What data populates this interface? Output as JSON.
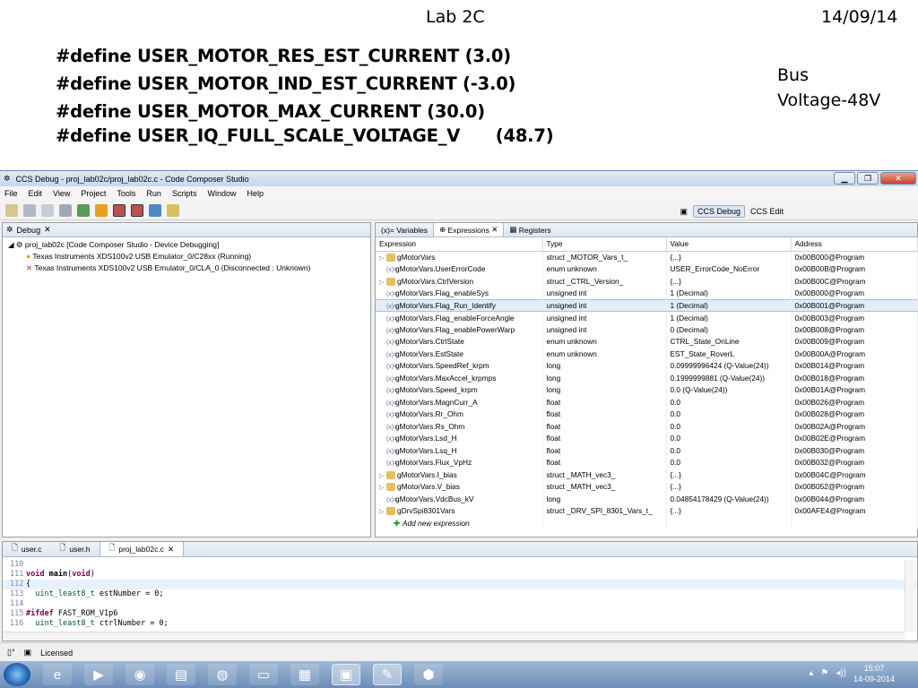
{
  "slide": {
    "title": "Lab 2C",
    "date": "14/09/14",
    "defines": [
      "#define USER_MOTOR_RES_EST_CURRENT (3.0)",
      "#define USER_MOTOR_IND_EST_CURRENT (-3.0)",
      "#define USER_MOTOR_MAX_CURRENT (30.0)",
      "#define USER_IQ_FULL_SCALE_VOLTAGE_V      (48.7)"
    ],
    "bus_line1": "Bus",
    "bus_line2": "Voltage-48V"
  },
  "window": {
    "title": "CCS Debug - proj_lab02c/proj_lab02c.c - Code Composer Studio",
    "menu": [
      "File",
      "Edit",
      "View",
      "Project",
      "Tools",
      "Run",
      "Scripts",
      "Window",
      "Help"
    ],
    "perspectives": [
      "CCS Debug",
      "CCS Edit"
    ]
  },
  "debug_view": {
    "tab": "Debug",
    "root": "proj_lab02c [Code Composer Studio - Device Debugging]",
    "children": [
      "Texas Instruments XDS100v2 USB Emulator_0/C28xx (Running)",
      "Texas Instruments XDS100v2 USB Emulator_0/CLA_0 (Disconnected : Unknown)"
    ]
  },
  "expressions_view": {
    "tabs": [
      "Variables",
      "Expressions",
      "Registers"
    ],
    "columns": [
      "Expression",
      "Type",
      "Value",
      "Address"
    ],
    "rows": [
      {
        "expr": "gMotorVars",
        "type": "struct _MOTOR_Vars_t_",
        "value": "{...}",
        "addr": "0x00B000@Program",
        "kind": "struct"
      },
      {
        "expr": "gMotorVars.UserErrorCode",
        "type": "enum unknown",
        "value": "USER_ErrorCode_NoError",
        "addr": "0x00B00B@Program",
        "kind": "var"
      },
      {
        "expr": "gMotorVars.CtrlVersion",
        "type": "struct _CTRL_Version_",
        "value": "{...}",
        "addr": "0x00B00C@Program",
        "kind": "struct"
      },
      {
        "expr": "gMotorVars.Flag_enableSys",
        "type": "unsigned int",
        "value": "1 (Decimal)",
        "addr": "0x00B000@Program",
        "kind": "var"
      },
      {
        "expr": "gMotorVars.Flag_Run_Identify",
        "type": "unsigned int",
        "value": "1 (Decimal)",
        "addr": "0x00B001@Program",
        "kind": "var"
      },
      {
        "expr": "gMotorVars.Flag_enableForceAngle",
        "type": "unsigned int",
        "value": "1 (Decimal)",
        "addr": "0x00B003@Program",
        "kind": "var"
      },
      {
        "expr": "gMotorVars.Flag_enablePowerWarp",
        "type": "unsigned int",
        "value": "0 (Decimal)",
        "addr": "0x00B008@Program",
        "kind": "var"
      },
      {
        "expr": "gMotorVars.CtrlState",
        "type": "enum unknown",
        "value": "CTRL_State_OnLine",
        "addr": "0x00B009@Program",
        "kind": "var"
      },
      {
        "expr": "gMotorVars.EstState",
        "type": "enum unknown",
        "value": "EST_State_RoverL",
        "addr": "0x00B00A@Program",
        "kind": "var"
      },
      {
        "expr": "gMotorVars.SpeedRef_krpm",
        "type": "long",
        "value": "0.09999996424 (Q-Value(24))",
        "addr": "0x00B014@Program",
        "kind": "var"
      },
      {
        "expr": "gMotorVars.MaxAccel_krpmps",
        "type": "long",
        "value": "0.1999999881 (Q-Value(24))",
        "addr": "0x00B018@Program",
        "kind": "var"
      },
      {
        "expr": "gMotorVars.Speed_krpm",
        "type": "long",
        "value": "0.0 (Q-Value(24))",
        "addr": "0x00B01A@Program",
        "kind": "var"
      },
      {
        "expr": "gMotorVars.MagnCurr_A",
        "type": "float",
        "value": "0.0",
        "addr": "0x00B026@Program",
        "kind": "var"
      },
      {
        "expr": "gMotorVars.Rr_Ohm",
        "type": "float",
        "value": "0.0",
        "addr": "0x00B028@Program",
        "kind": "var"
      },
      {
        "expr": "gMotorVars.Rs_Ohm",
        "type": "float",
        "value": "0.0",
        "addr": "0x00B02A@Program",
        "kind": "var"
      },
      {
        "expr": "gMotorVars.Lsd_H",
        "type": "float",
        "value": "0.0",
        "addr": "0x00B02E@Program",
        "kind": "var"
      },
      {
        "expr": "gMotorVars.Lsq_H",
        "type": "float",
        "value": "0.0",
        "addr": "0x00B030@Program",
        "kind": "var"
      },
      {
        "expr": "gMotorVars.Flux_VpHz",
        "type": "float",
        "value": "0.0",
        "addr": "0x00B032@Program",
        "kind": "var"
      },
      {
        "expr": "gMotorVars.I_bias",
        "type": "struct _MATH_vec3_",
        "value": "{...}",
        "addr": "0x00B04C@Program",
        "kind": "struct"
      },
      {
        "expr": "gMotorVars.V_bias",
        "type": "struct _MATH_vec3_",
        "value": "{...}",
        "addr": "0x00B052@Program",
        "kind": "struct"
      },
      {
        "expr": "gMotorVars.VdcBus_kV",
        "type": "long",
        "value": "0.04854178429 (Q-Value(24))",
        "addr": "0x00B044@Program",
        "kind": "var"
      },
      {
        "expr": "gDrvSpi8301Vars",
        "type": "struct _DRV_SPI_8301_Vars_t_",
        "value": "{...}",
        "addr": "0x00AFE4@Program",
        "kind": "struct"
      }
    ],
    "add_label": "Add new expression"
  },
  "editor": {
    "tabs": [
      "user.c",
      "user.h",
      "proj_lab02c.c"
    ]
  },
  "status": {
    "license": "Licensed"
  },
  "taskbar": {
    "time": "15:07",
    "date": "14-09-2014"
  }
}
